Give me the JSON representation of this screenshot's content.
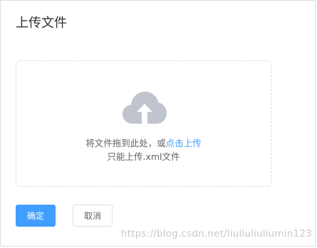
{
  "dialog": {
    "title": "上传文件"
  },
  "dropzone": {
    "icon": "cloud-upload-icon",
    "prompt_text": "将文件拖到此处，或",
    "upload_link": "点击上传",
    "hint": "只能上传.xml文件"
  },
  "footer": {
    "confirm_label": "确定",
    "cancel_label": "取消"
  },
  "watermark": "https://blog.csdn.net/liuliuliuliumin123",
  "colors": {
    "accent": "#409eff",
    "icon_gray": "#c0c4cc",
    "text": "#606266"
  }
}
